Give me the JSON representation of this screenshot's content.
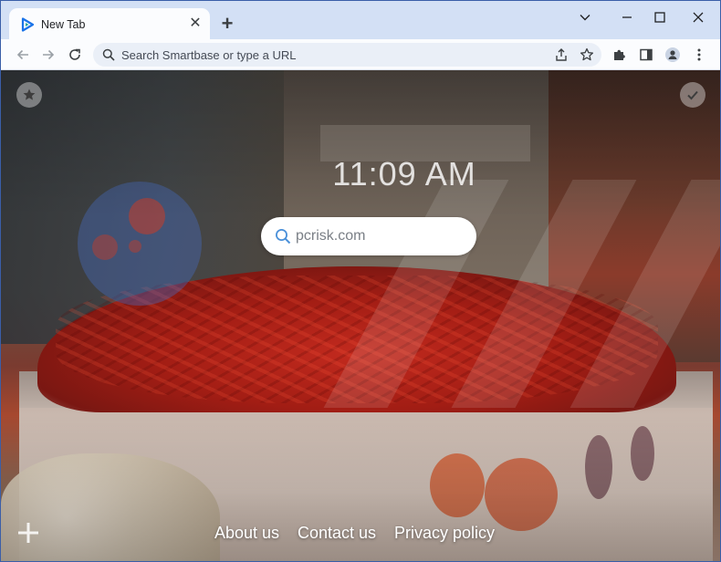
{
  "browser": {
    "tab_title": "New Tab",
    "address_placeholder": "Search Smartbase or type a URL"
  },
  "newtab": {
    "clock": "11:09 AM",
    "search_placeholder": "pcrisk.com",
    "footer": {
      "about": "About us",
      "contact": "Contact us",
      "privacy": "Privacy policy"
    }
  },
  "colors": {
    "tab_strip": "#d3e0f5",
    "toolbar": "#fbfcfe",
    "omnibox": "#eaeff7",
    "favicon_accent": "#1a73e8"
  },
  "icons": {
    "favicon": "play-triangle-icon",
    "back": "arrow-left-icon",
    "forward": "arrow-right-icon",
    "reload": "reload-icon",
    "share": "share-icon",
    "bookmark": "star-outline-icon",
    "extensions": "puzzle-icon",
    "side_panel": "side-panel-icon",
    "profile": "person-icon",
    "menu": "kebab-icon",
    "favorites": "star-icon",
    "check": "check-icon",
    "add": "plus-icon",
    "search": "magnifier-icon"
  }
}
